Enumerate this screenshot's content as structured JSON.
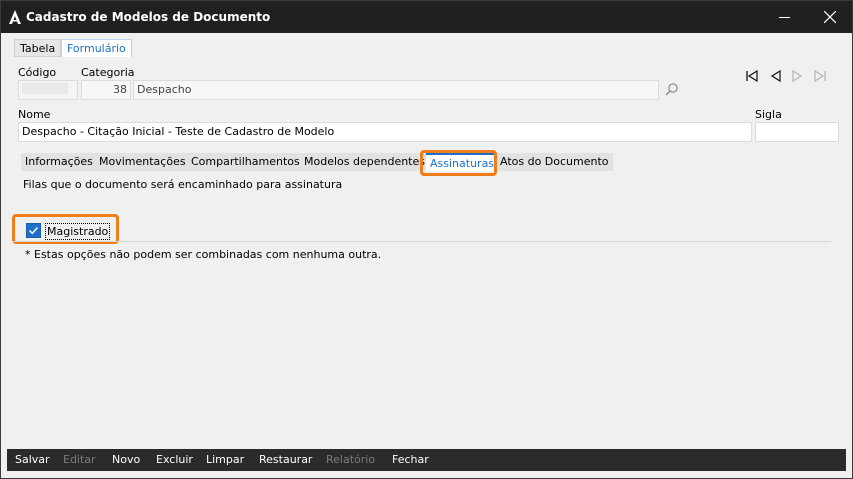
{
  "window": {
    "title": "Cadastro de Modelos de Documento"
  },
  "top_tabs": [
    {
      "label": "Tabela",
      "active": false
    },
    {
      "label": "Formulário",
      "active": true
    }
  ],
  "form": {
    "codigo_label": "Código",
    "categoria_label": "Categoria",
    "categoria_code": "38",
    "categoria_name": "Despacho",
    "nome_label": "Nome",
    "nome_value": "Despacho - Citação Inicial - Teste de Cadastro de Modelo",
    "sigla_label": "Sigla",
    "sigla_value": ""
  },
  "sub_tabs": [
    {
      "label": "Informações"
    },
    {
      "label": "Movimentações"
    },
    {
      "label": "Compartilhamentos"
    },
    {
      "label": "Modelos dependentes"
    },
    {
      "label": "Assinaturas",
      "active": true
    },
    {
      "label": "Atos do Documento"
    }
  ],
  "assinaturas": {
    "description": "Filas que o documento será encaminhado para assinatura",
    "checkbox_label": "Magistrado",
    "checked": true,
    "note": "* Estas opções não podem ser combinadas com nenhuma outra."
  },
  "bottom_bar": [
    {
      "label": "Salvar",
      "enabled": true
    },
    {
      "label": "Editar",
      "enabled": false
    },
    {
      "label": "Novo",
      "enabled": true
    },
    {
      "label": "Excluir",
      "enabled": true
    },
    {
      "label": "Limpar",
      "enabled": true
    },
    {
      "label": "Restaurar",
      "enabled": true
    },
    {
      "label": "Relatório",
      "enabled": false
    },
    {
      "label": "Fechar",
      "enabled": true
    }
  ],
  "colors": {
    "accent": "#1a6fc9",
    "highlight": "#ef7d1a",
    "titlebar": "#202020"
  }
}
